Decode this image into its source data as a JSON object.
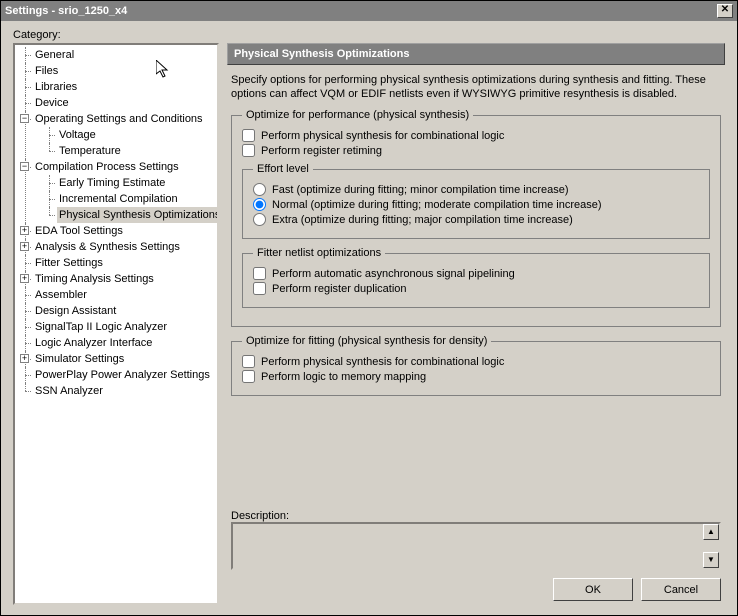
{
  "window": {
    "title": "Settings - srio_1250_x4"
  },
  "category_label": "Category:",
  "tree": {
    "general": "General",
    "files": "Files",
    "libraries": "Libraries",
    "device": "Device",
    "operating": "Operating Settings and Conditions",
    "voltage": "Voltage",
    "temperature": "Temperature",
    "compilation": "Compilation Process Settings",
    "early_timing": "Early Timing Estimate",
    "incremental": "Incremental Compilation",
    "phys_synth": "Physical Synthesis Optimizations",
    "eda": "EDA Tool Settings",
    "analysis": "Analysis & Synthesis Settings",
    "fitter": "Fitter Settings",
    "timing": "Timing Analysis Settings",
    "assembler": "Assembler",
    "design_assist": "Design Assistant",
    "signaltap": "SignalTap II Logic Analyzer",
    "logic_analyzer": "Logic Analyzer Interface",
    "simulator": "Simulator Settings",
    "powerplay": "PowerPlay Power Analyzer Settings",
    "ssn": "SSN Analyzer"
  },
  "panel": {
    "title": "Physical Synthesis Optimizations",
    "intro": "Specify options for performing physical synthesis optimizations during synthesis and fitting. These options can affect VQM or EDIF netlists even if WYSIWYG primitive resynthesis is disabled.",
    "group1": {
      "legend": "Optimize for performance (physical synthesis)",
      "chk1": "Perform physical synthesis for combinational logic",
      "chk2": "Perform register retiming",
      "effort_legend": "Effort level",
      "rad1": "Fast (optimize during fitting; minor compilation time increase)",
      "rad2": "Normal (optimize during fitting; moderate compilation time increase)",
      "rad3": "Extra (optimize during fitting; major compilation time increase)",
      "fitter_legend": "Fitter netlist optimizations",
      "chk3": "Perform automatic asynchronous signal pipelining",
      "chk4": "Perform register duplication"
    },
    "group2": {
      "legend": "Optimize for fitting (physical synthesis for density)",
      "chk1": "Perform physical synthesis for combinational logic",
      "chk2": "Perform logic to memory mapping"
    },
    "desc_label": "Description:"
  },
  "buttons": {
    "ok": "OK",
    "cancel": "Cancel"
  }
}
